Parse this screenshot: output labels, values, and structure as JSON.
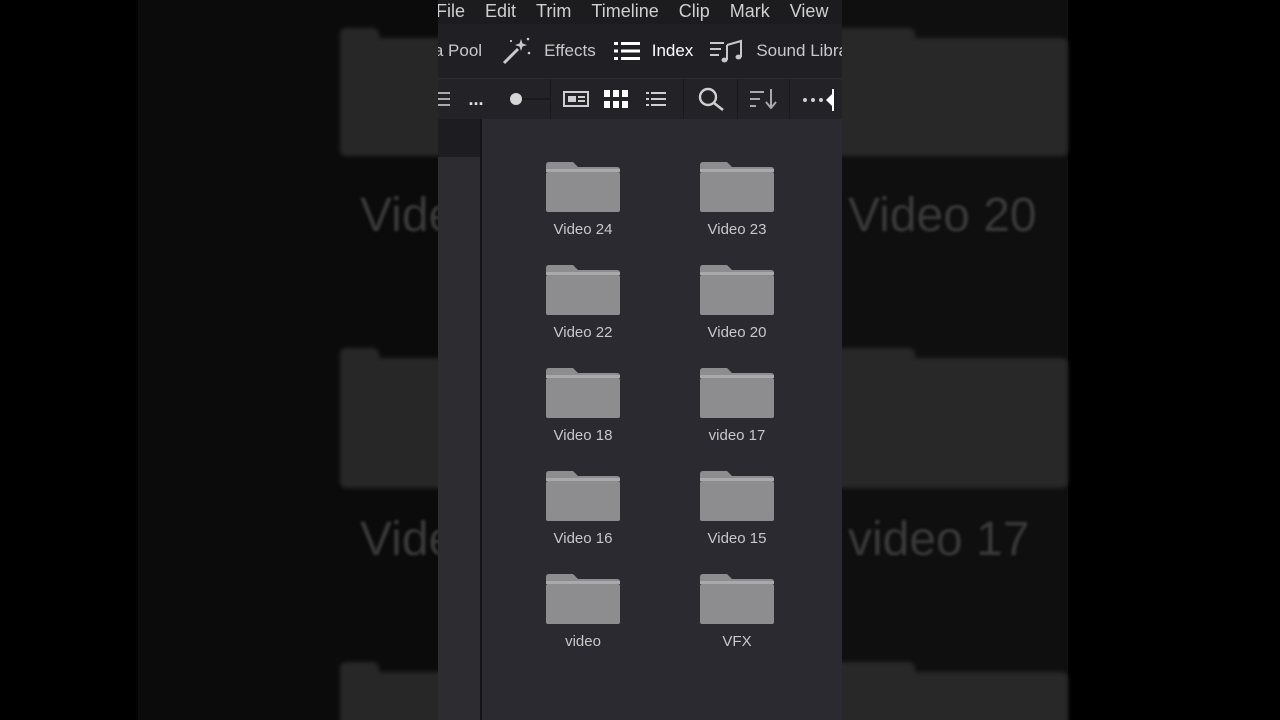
{
  "menu": [
    "File",
    "Edit",
    "Trim",
    "Timeline",
    "Clip",
    "Mark",
    "View"
  ],
  "tabs": [
    {
      "label": "Media Pool",
      "icon": "media-pool-icon",
      "active": false
    },
    {
      "label": "Effects",
      "icon": "effects-wand-icon",
      "active": false
    },
    {
      "label": "Index",
      "icon": "index-list-icon",
      "active": true
    },
    {
      "label": "Sound Library",
      "icon": "sound-library-icon",
      "active": false
    }
  ],
  "toolbar": {
    "more_label": "...",
    "icons": [
      "filter-icon",
      "zoom-slider",
      "metadata-view-icon",
      "thumbnail-view-icon",
      "list-view-icon",
      "search-icon",
      "sort-icon",
      "options-icon"
    ]
  },
  "folders": [
    {
      "label": "Video 24"
    },
    {
      "label": "Video 23"
    },
    {
      "label": "Video 22"
    },
    {
      "label": "Video 20"
    },
    {
      "label": "Video 18"
    },
    {
      "label": "video 17"
    },
    {
      "label": "Video 16"
    },
    {
      "label": "Video 15"
    },
    {
      "label": "video"
    },
    {
      "label": "VFX"
    }
  ],
  "background": {
    "labels": [
      "Video 20",
      "video 17",
      "Video",
      "Vide"
    ]
  },
  "colors": {
    "panel": "#2b2a31",
    "folder": "#8d8d8f",
    "folder_light": "#a9a9ab",
    "text": "#c8c8c8"
  }
}
